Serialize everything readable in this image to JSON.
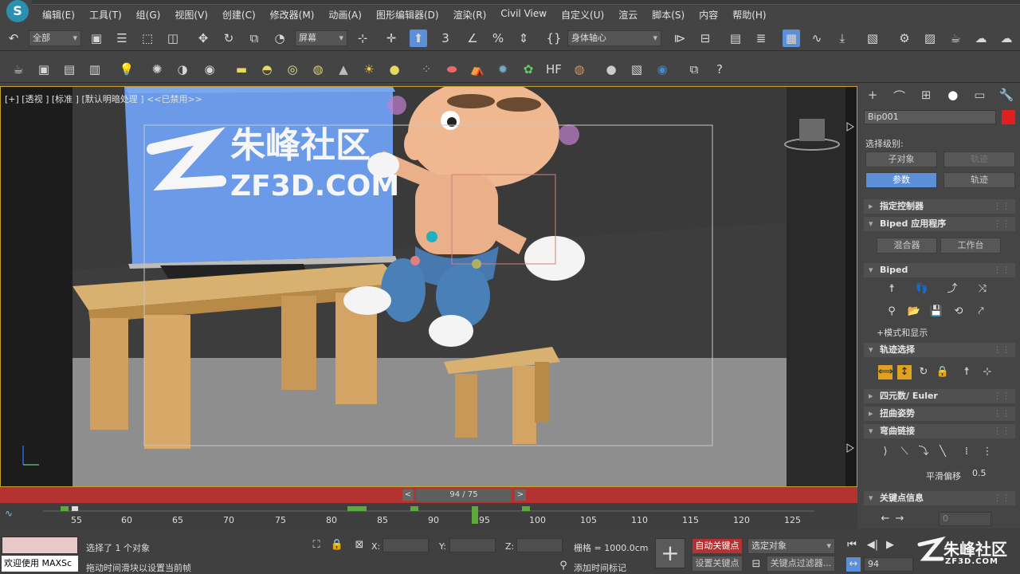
{
  "app_icon": "3ds-max-logo",
  "menubar": {
    "items": [
      "编辑(E)",
      "工具(T)",
      "组(G)",
      "视图(V)",
      "创建(C)",
      "修改器(M)",
      "动画(A)",
      "图形编辑器(D)",
      "渲染(R)",
      "Civil View",
      "自定义(U)",
      "渲云",
      "脚本(S)",
      "内容",
      "帮助(H)"
    ]
  },
  "toolbar1": {
    "filter_value": "全部",
    "selection_set_value": "屏幕",
    "snap_label": "3",
    "pivot_value": "身体轴心"
  },
  "viewport": {
    "label": "[+] [透视 ] [标准 ] [默认明暗处理 ]  <<已禁用>>",
    "watermark_name": "朱峰社区",
    "watermark_url": "ZF3D.COM",
    "frame_indicator": "94 / 75",
    "prev_label": "<",
    "next_label": ">"
  },
  "command_panel": {
    "object_name": "Bip001",
    "object_color": "#e02020",
    "select_level_label": "选择级别:",
    "sub_object_btn": "子对象",
    "track_btn_disabled": "轨迹",
    "params_btn": "参数",
    "track_btn": "轨迹",
    "rollouts": {
      "assign_controller": "指定控制器",
      "biped_app": "Biped 应用程序",
      "mixer_btn": "混合器",
      "workbench_btn": "工作台",
      "biped": "Biped",
      "mode_display": "+模式和显示",
      "track_select": "轨迹选择",
      "quaternion": "四元数/ Euler",
      "twist_pose": "扭曲姿势",
      "bend_links": "弯曲链接",
      "smooth_bias_label": "平滑偏移",
      "smooth_bias_value": "0.5",
      "key_info": "关键点信息",
      "key_value": "0"
    }
  },
  "timeline": {
    "ticks": [
      "55",
      "60",
      "65",
      "70",
      "75",
      "80",
      "85",
      "90",
      "95",
      "100",
      "105",
      "110",
      "115",
      "120",
      "125"
    ]
  },
  "status": {
    "maxscript_label": "欢迎使用 MAXSc",
    "selected_text": "选择了 1 个对象",
    "hint_text": "拖动时间滑块以设置当前帧",
    "x_label": "X:",
    "y_label": "Y:",
    "z_label": "Z:",
    "grid_text": "栅格 = 1000.0cm",
    "add_time_tag": "添加时间标记",
    "auto_key": "自动关键点",
    "set_key": "设置关键点",
    "selected_object": "选定对象",
    "key_filters": "关键点过滤器...",
    "current_frame": "94"
  }
}
